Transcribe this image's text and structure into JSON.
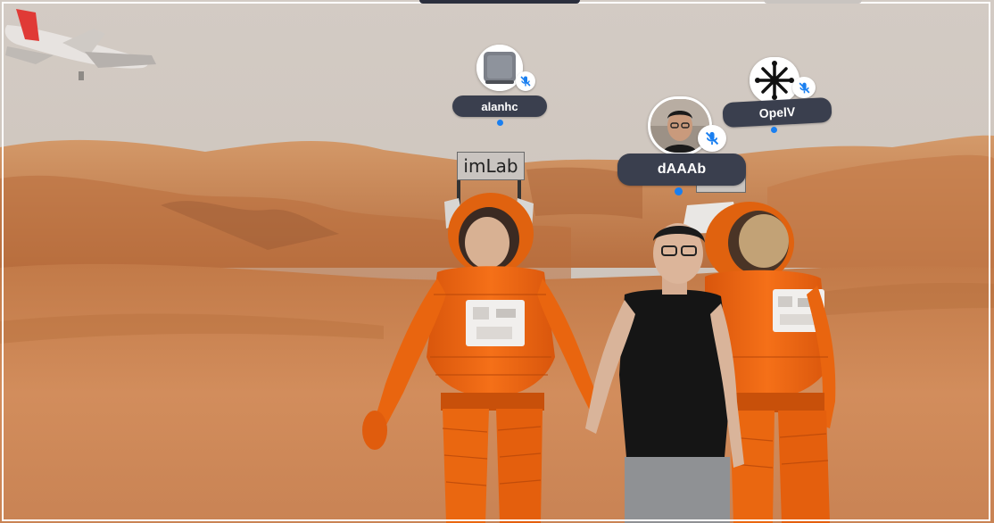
{
  "users": [
    {
      "name": "alanhc",
      "avatar": "computer-avatar-icon",
      "muted": true
    },
    {
      "name": "dAAAb",
      "avatar": "person-photo-avatar",
      "muted": true
    },
    {
      "name": "OpelV",
      "avatar": "compass-star-avatar-icon",
      "muted": true
    }
  ],
  "signs": [
    "imLab",
    "imLab"
  ],
  "colors": {
    "name_tag_bg": "#3a3f4e",
    "presence_dot": "#1a7ff0",
    "mute_icon": "#1a7ff0",
    "sky": "#d0c7bf",
    "terrain": "#c8804f",
    "suit": "#f06a12"
  }
}
